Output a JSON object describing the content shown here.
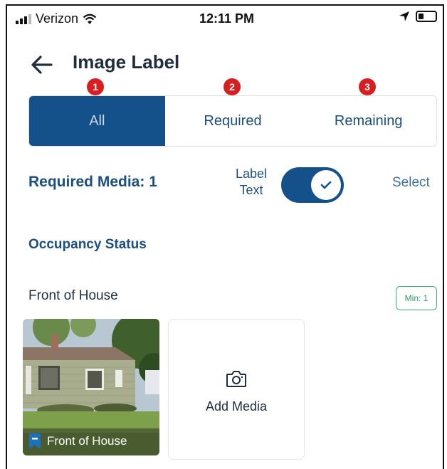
{
  "status_bar": {
    "carrier": "Verizon",
    "time": "12:11 PM"
  },
  "header": {
    "title": "Image Label"
  },
  "badges": [
    "1",
    "2",
    "3"
  ],
  "tabs": [
    {
      "label": "All",
      "active": true
    },
    {
      "label": "Required",
      "active": false
    },
    {
      "label": "Remaining",
      "active": false
    }
  ],
  "controls": {
    "required_media": "Required Media: 1",
    "label_text_line1": "Label",
    "label_text_line2": "Text",
    "toggle_on": true,
    "select_label": "Select"
  },
  "sections": {
    "occupancy_status": "Occupancy Status",
    "group_title": "Front of House",
    "min_badge": "Min: 1"
  },
  "media": {
    "photo_caption": "Front of House",
    "add_label": "Add Media"
  },
  "colors": {
    "primary": "#14508a",
    "badge_red": "#d81e1e",
    "min_green": "#3bb07a"
  }
}
